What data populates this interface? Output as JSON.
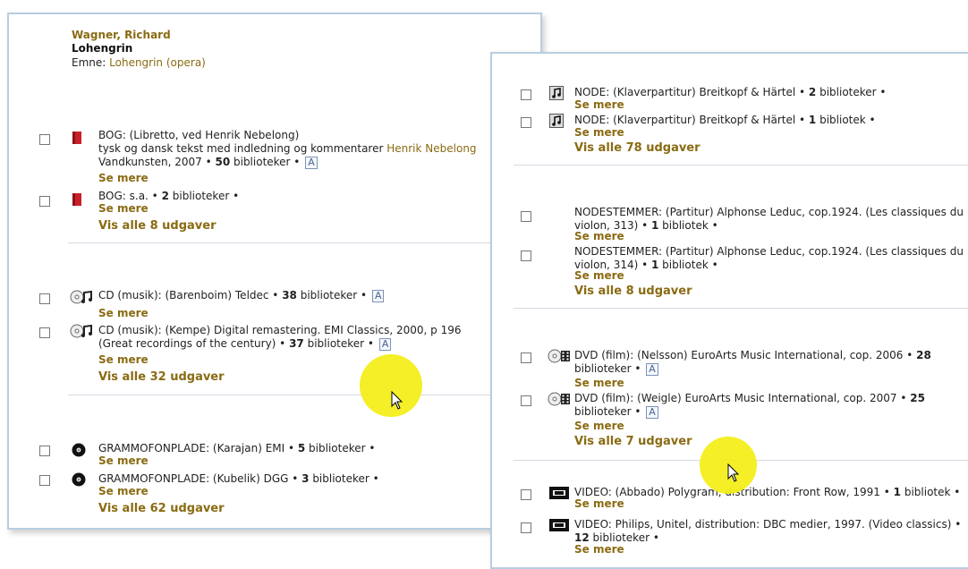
{
  "left": {
    "work": {
      "author": "Wagner, Richard",
      "title": "Lohengrin",
      "subject_label": "Emne:",
      "subject_link": "Lohengrin (opera)"
    },
    "groups": [
      {
        "items": [
          {
            "icon": "book-icon",
            "line1": "BOG: (Libretto, ved Henrik Nebelong)",
            "line2_text": "tysk og dansk tekst med indledning og kommentarer ",
            "line2_link": "Henrik Nebelong",
            "line3_pre": "Vandkunsten, 2007 • ",
            "count": "50",
            "line3_post": " biblioteker •",
            "a_badge": "A",
            "se_mere": "Se mere"
          },
          {
            "icon": "book-icon",
            "line1_pre": "BOG: s.a. • ",
            "count": "2",
            "line1_post": " biblioteker •",
            "se_mere": "Se mere"
          }
        ],
        "vis_alle": "Vis alle 8 udgaver"
      },
      {
        "items": [
          {
            "icon": "cd-music-icon",
            "line1_pre": "CD (musik): (Barenboim) Teldec • ",
            "count": "38",
            "line1_post": " biblioteker •",
            "a_badge": "A",
            "se_mere": "Se mere"
          },
          {
            "icon": "cd-music-icon",
            "line1": "CD (musik): (Kempe) Digital remastering. EMI Classics, 2000, p 196",
            "line2_pre": "(Great recordings of the century) • ",
            "count": "37",
            "line2_post": " biblioteker •",
            "a_badge": "A",
            "se_mere": "Se mere"
          }
        ],
        "vis_alle": "Vis alle 32 udgaver"
      },
      {
        "items": [
          {
            "icon": "vinyl-record-icon",
            "line1_pre": "GRAMMOFONPLADE: (Karajan) EMI • ",
            "count": "5",
            "line1_post": " biblioteker •",
            "se_mere": "Se mere"
          },
          {
            "icon": "vinyl-record-icon",
            "line1_pre": "GRAMMOFONPLADE: (Kubelik) DGG • ",
            "count": "3",
            "line1_post": " biblioteker •",
            "se_mere": "Se mere"
          }
        ],
        "vis_alle": "Vis alle 62 udgaver"
      }
    ]
  },
  "right": {
    "groups": [
      {
        "items": [
          {
            "icon": "sheet-music-icon",
            "line1_pre": "NODE: (Klaverpartitur) Breitkopf & Härtel • ",
            "count": "2",
            "line1_post": " biblioteker •",
            "se_mere": "Se mere"
          },
          {
            "icon": "sheet-music-icon",
            "line1_pre": "NODE: (Klaverpartitur) Breitkopf & Härtel • ",
            "count": "1",
            "line1_post": " bibliotek •",
            "se_mere": "Se mere"
          }
        ],
        "vis_alle": "Vis alle 78 udgaver"
      },
      {
        "items": [
          {
            "line1": "NODESTEMMER: (Partitur) Alphonse Leduc, cop.1924. (Les classiques du",
            "line2_pre": "violon, 313) • ",
            "count": "1",
            "line2_post": " bibliotek •",
            "se_mere": "Se mere"
          },
          {
            "line1": "NODESTEMMER: (Partitur) Alphonse Leduc, cop.1924. (Les classiques du",
            "line2_pre": "violon, 314) • ",
            "count": "1",
            "line2_post": " bibliotek •",
            "se_mere": "Se mere"
          }
        ],
        "vis_alle": "Vis alle 8 udgaver"
      },
      {
        "items": [
          {
            "icon": "dvd-film-icon",
            "line1_pre": "DVD (film): (Nelsson) EuroArts Music International, cop. 2006 • ",
            "count": "28",
            "line2": "biblioteker •",
            "a_badge": "A",
            "se_mere": "Se mere"
          },
          {
            "icon": "dvd-film-icon",
            "line1_pre": "DVD (film): (Weigle) EuroArts Music International, cop. 2007 • ",
            "count": "25",
            "line2": "biblioteker •",
            "a_badge": "A",
            "se_mere": "Se mere"
          }
        ],
        "vis_alle": "Vis alle 7 udgaver"
      },
      {
        "items": [
          {
            "icon": "video-tape-icon",
            "line1_pre": "VIDEO: (Abbado) Polygram, distribution: Front Row, 1991 • ",
            "count": "1",
            "line1_post": " bibliotek •",
            "se_mere": "Se mere"
          },
          {
            "icon": "video-tape-icon",
            "line1": "VIDEO: Philips, Unitel, distribution: DBC medier, 1997. (Video classics) •",
            "count": "12",
            "line2_post": " biblioteker •",
            "se_mere": "Se mere"
          }
        ]
      }
    ]
  },
  "colors": {
    "link_gold": "#8a6b12",
    "panel_border": "#b8cde0",
    "cursor_highlight": "#f3ee1a"
  }
}
